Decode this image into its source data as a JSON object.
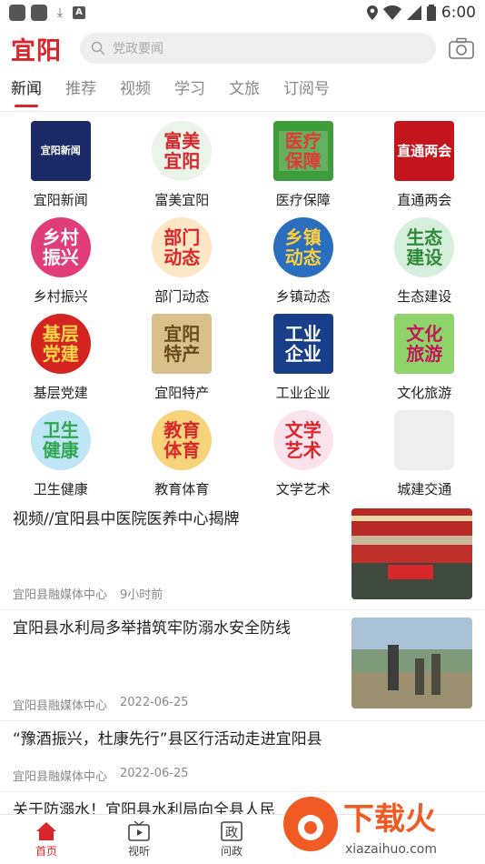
{
  "status": {
    "time": "6:00",
    "battery": "6"
  },
  "header": {
    "logo": "宜阳",
    "search_placeholder": "党政要闻"
  },
  "tabs": [
    "新闻",
    "推荐",
    "视频",
    "学习",
    "文旅",
    "订阅号"
  ],
  "grid": [
    {
      "label": "宜阳新闻",
      "icon_text": "宜阳新闻",
      "color": "#1b2a66"
    },
    {
      "label": "富美宜阳",
      "icon_text": "富美宜阳",
      "color": "#e9f3e6"
    },
    {
      "label": "医疗保障",
      "icon_text": "医疗保障",
      "color": "#3c9d3a"
    },
    {
      "label": "直通两会",
      "icon_text": "直通两会",
      "color": "#c3151b"
    },
    {
      "label": "乡村振兴",
      "icon_text": "乡村振兴",
      "color": "#e23d7b"
    },
    {
      "label": "部门动态",
      "icon_text": "部门动态",
      "color": "#f6b24a"
    },
    {
      "label": "乡镇动态",
      "icon_text": "乡镇动态",
      "color": "#2a6fbf"
    },
    {
      "label": "生态建设",
      "icon_text": "生态建设",
      "color": "#3ea86a"
    },
    {
      "label": "基层党建",
      "icon_text": "基层党建",
      "color": "#d4241f"
    },
    {
      "label": "宜阳特产",
      "icon_text": "宜阳特产",
      "color": "#c9a86a"
    },
    {
      "label": "工业企业",
      "icon_text": "工业企业",
      "color": "#1a3f8a"
    },
    {
      "label": "文化旅游",
      "icon_text": "文化旅游",
      "color": "#6fbf4c"
    },
    {
      "label": "卫生健康",
      "icon_text": "卫生健康",
      "color": "#36a7d9"
    },
    {
      "label": "教育体育",
      "icon_text": "教育体育",
      "color": "#e8a02b"
    },
    {
      "label": "文学艺术",
      "icon_text": "文学艺术",
      "color": "#f4d3e4"
    },
    {
      "label": "城建交通",
      "icon_text": "",
      "color": "#eeeeee"
    }
  ],
  "news": [
    {
      "title": "视频//宜阳县中医院医养中心揭牌",
      "source": "宜阳县融媒体中心",
      "time": "9小时前",
      "has_image": true
    },
    {
      "title": "宜阳县水利局多举措筑牢防溺水安全防线",
      "source": "宜阳县融媒体中心",
      "time": "2022-06-25",
      "has_image": true
    },
    {
      "title": "“豫酒振兴，杜康先行”县区行活动走进宜阳县",
      "source": "宜阳县融媒体中心",
      "time": "2022-06-25",
      "has_image": false
    },
    {
      "title": "关于防溺水！宜阳县水利局向全县人民",
      "source": "",
      "time": "",
      "has_image": true
    }
  ],
  "bottom_nav": [
    {
      "label": "首页",
      "icon": "home-icon",
      "active": true
    },
    {
      "label": "视听",
      "icon": "tv-icon",
      "active": false
    },
    {
      "label": "问政",
      "icon": "zheng-icon",
      "active": false
    }
  ],
  "watermark": {
    "brand": "下载火",
    "url": "xiazaihuo.com"
  },
  "colors": {
    "accent": "#d8262a"
  }
}
